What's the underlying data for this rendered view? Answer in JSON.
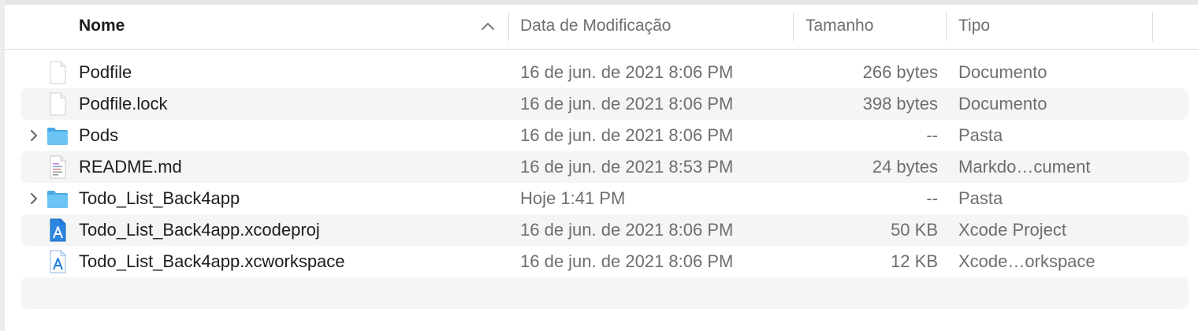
{
  "columns": {
    "name": "Nome",
    "date": "Data de Modificação",
    "size": "Tamanho",
    "kind": "Tipo"
  },
  "sort": {
    "column": "name",
    "direction": "ascending",
    "icon": "chevron-up-icon"
  },
  "files": [
    {
      "name": "Podfile",
      "date": "16 de jun. de 2021 8:06 PM",
      "size": "266 bytes",
      "kind": "Documento",
      "icon": "document-icon",
      "expandable": false
    },
    {
      "name": "Podfile.lock",
      "date": "16 de jun. de 2021 8:06 PM",
      "size": "398 bytes",
      "kind": "Documento",
      "icon": "document-icon",
      "expandable": false
    },
    {
      "name": "Pods",
      "date": "16 de jun. de 2021 8:06 PM",
      "size": "--",
      "kind": "Pasta",
      "icon": "folder-icon",
      "expandable": true
    },
    {
      "name": "README.md",
      "date": "16 de jun. de 2021 8:53 PM",
      "size": "24 bytes",
      "kind": "Markdo…cument",
      "icon": "text-document-icon",
      "expandable": false
    },
    {
      "name": "Todo_List_Back4app",
      "date": "Hoje 1:41 PM",
      "size": "--",
      "kind": "Pasta",
      "icon": "folder-icon",
      "expandable": true
    },
    {
      "name": "Todo_List_Back4app.xcodeproj",
      "date": "16 de jun. de 2021 8:06 PM",
      "size": "50 KB",
      "kind": "Xcode Project",
      "icon": "xcode-project-icon",
      "expandable": false
    },
    {
      "name": "Todo_List_Back4app.xcworkspace",
      "date": "16 de jun. de 2021 8:06 PM",
      "size": "12 KB",
      "kind": "Xcode…orkspace",
      "icon": "xcode-workspace-icon",
      "expandable": false
    }
  ],
  "colors": {
    "folder": "#5ab8ee",
    "row_alt": "#f4f5f5",
    "xcode": "#1b7bd8"
  }
}
